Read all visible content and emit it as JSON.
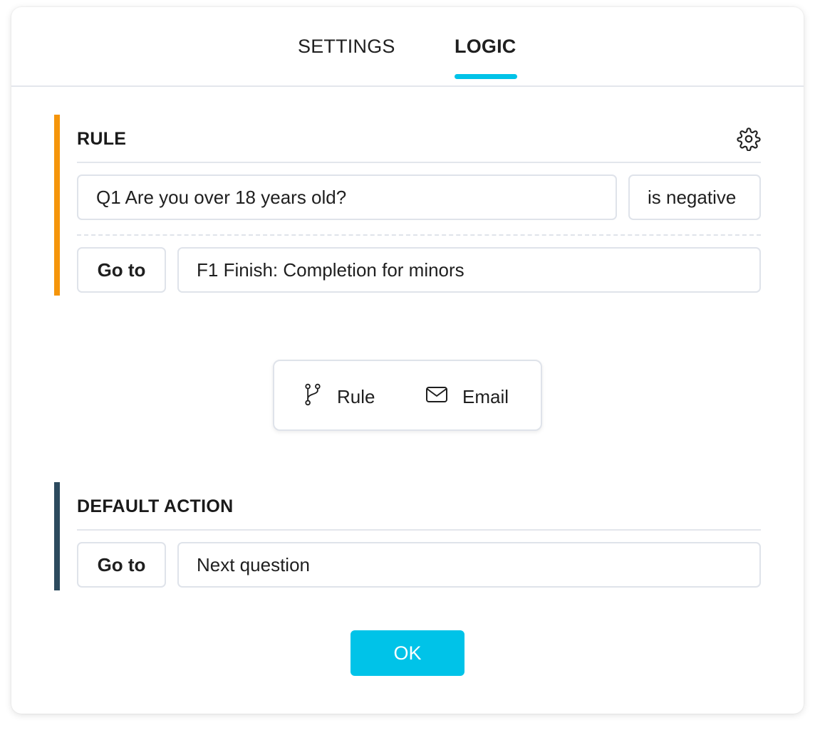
{
  "tabs": [
    {
      "label": "SETTINGS",
      "active": false
    },
    {
      "label": "LOGIC",
      "active": true
    }
  ],
  "colors": {
    "accent": "#00c3e8",
    "rule_accent": "#f5950a",
    "default_accent": "#2c4a5e",
    "border": "#dfe3ea"
  },
  "rule": {
    "title": "RULE",
    "settings_icon": "gear-icon",
    "question": "Q1 Are you over 18 years old?",
    "condition": "is negative",
    "action_label": "Go to",
    "action_target": "F1 Finish: Completion for minors"
  },
  "add_menu": {
    "items": [
      {
        "label": "Rule",
        "icon": "branch-icon"
      },
      {
        "label": "Email",
        "icon": "envelope-icon"
      }
    ]
  },
  "default_action": {
    "title": "DEFAULT ACTION",
    "action_label": "Go to",
    "action_target": "Next question"
  },
  "ok_button": {
    "label": "OK"
  }
}
